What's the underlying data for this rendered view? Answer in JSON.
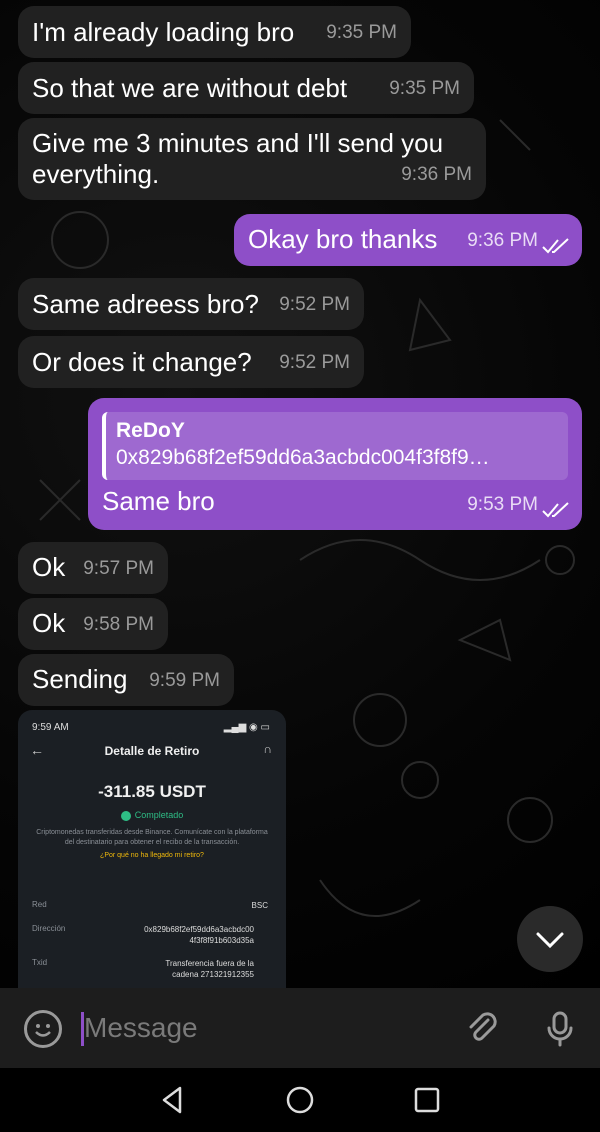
{
  "messages": [
    {
      "text": "I'm already loading bro",
      "time": "9:35 PM"
    },
    {
      "text": "So that we are without debt",
      "time": "9:35 PM"
    },
    {
      "text_line1": "Give me 3 minutes and I'll send you",
      "text_line2": "everything.",
      "time": "9:36 PM"
    },
    {
      "text": "Okay bro thanks",
      "time": "9:36 PM",
      "status": "read"
    },
    {
      "text": "Same adreess bro?",
      "time": "9:52 PM"
    },
    {
      "text": "Or does it change?",
      "time": "9:52 PM"
    },
    {
      "reply_name": "ReDoY",
      "reply_text": "0x829b68f2ef59dd6a3acbdc004f3f8f9…",
      "text": "Same bro",
      "time": "9:53 PM",
      "status": "read"
    },
    {
      "text": "Ok",
      "time": "9:57 PM"
    },
    {
      "text": "Ok",
      "time": "9:58 PM"
    },
    {
      "text": "Sending",
      "time": "9:59 PM"
    }
  ],
  "photo": {
    "status_time": "9:59 AM",
    "title": "Detalle de Retiro",
    "amount": "-311.85 USDT",
    "status": "Completado",
    "description": "Criptomonedas transferidas desde Binance. Comunícate con la plataforma del destinatario para obtener el recibo de la transacción.",
    "link": "¿Por qué no ha llegado mi retiro?",
    "rows": [
      {
        "label": "Red",
        "value": "BSC"
      },
      {
        "label": "Dirección",
        "value_line1": "0x829b68f2ef59dd6a3acbdc00",
        "value_line2": "4f3f8f91b603d35a"
      },
      {
        "label": "Txid",
        "value_line1": "Transferencia fuera de la",
        "value_line2": "cadena 271321912355"
      }
    ]
  },
  "composer": {
    "placeholder": "Message"
  },
  "icons": {
    "emoji": "emoji-icon",
    "attach": "paperclip-icon",
    "mic": "microphone-icon",
    "scroll_down": "chevron-down-icon",
    "read_status": "double-check-icon"
  },
  "colors": {
    "outgoing": "#8e4fc8",
    "incoming": "#212121",
    "success": "#2ebd85",
    "link": "#f0b90b"
  }
}
